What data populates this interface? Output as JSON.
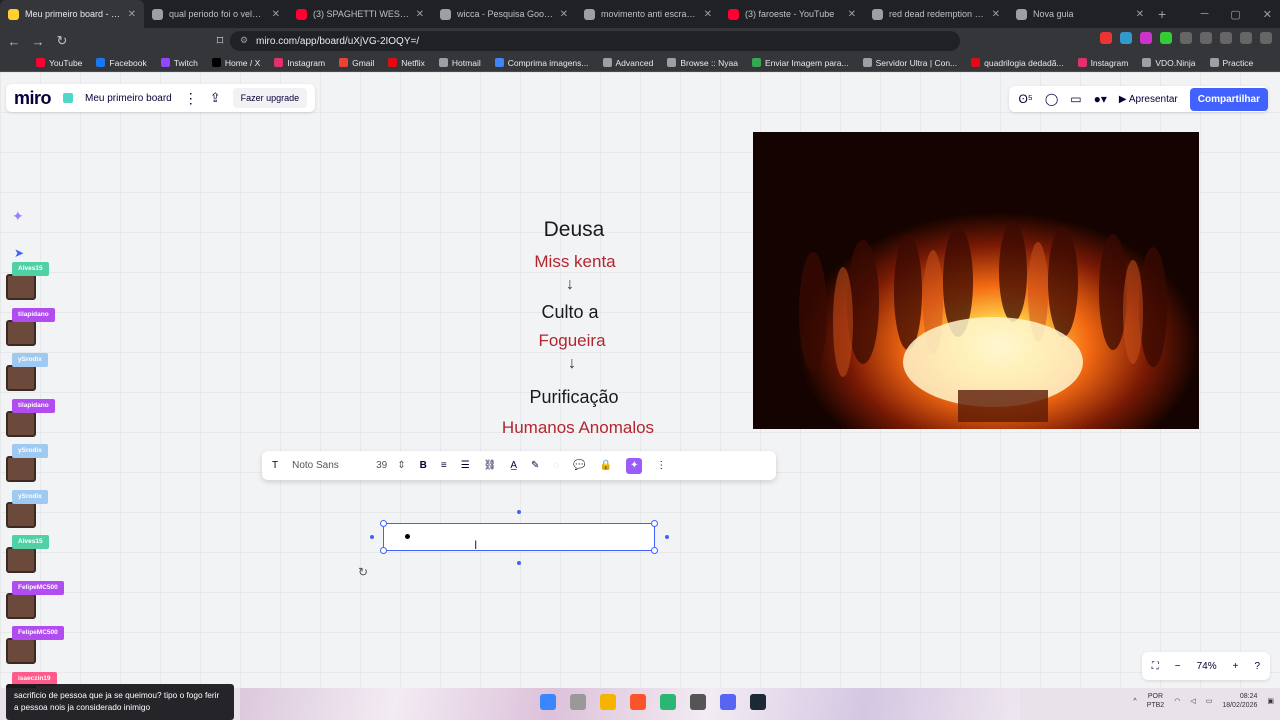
{
  "browser": {
    "tabs": [
      {
        "title": "Meu primeiro board - Miro",
        "color": "#ffd02f",
        "active": true
      },
      {
        "title": "qual periodo foi o velho oeste",
        "color": "#9aa0a6",
        "active": false
      },
      {
        "title": "(3) SPAGHETTI WESTERN BELLA",
        "color": "#ff0033",
        "active": false
      },
      {
        "title": "wicca - Pesquisa Google",
        "color": "#9aa0a6",
        "active": false
      },
      {
        "title": "movimento anti escravista - Pe",
        "color": "#9aa0a6",
        "active": false
      },
      {
        "title": "(3) faroeste - YouTube",
        "color": "#ff0033",
        "active": false
      },
      {
        "title": "red dead redemption 2 ritual -",
        "color": "#9aa0a6",
        "active": false
      },
      {
        "title": "Nova guia",
        "color": "#9aa0a6",
        "active": false
      }
    ],
    "url": "miro.com/app/board/uXjVG-2IOQY=/",
    "bookmarks": [
      {
        "label": "YouTube",
        "color": "#ff0033"
      },
      {
        "label": "Facebook",
        "color": "#1877f2"
      },
      {
        "label": "Twitch",
        "color": "#9146ff"
      },
      {
        "label": "Home / X",
        "color": "#000000"
      },
      {
        "label": "Instagram",
        "color": "#e1306c"
      },
      {
        "label": "Gmail",
        "color": "#ea4335"
      },
      {
        "label": "Netflix",
        "color": "#e50914"
      },
      {
        "label": "Hotmail",
        "color": "#9aa0a6"
      },
      {
        "label": "Comprima imagens...",
        "color": "#4285f4"
      },
      {
        "label": "Advanced",
        "color": "#9aa0a6"
      },
      {
        "label": "Browse :: Nyaa",
        "color": "#9aa0a6"
      },
      {
        "label": "Enviar Imagem para...",
        "color": "#34a853"
      },
      {
        "label": "Servidor Ultra | Con...",
        "color": "#9aa0a6"
      },
      {
        "label": "quadrilogia dedadã...",
        "color": "#e50914"
      },
      {
        "label": "Instagram",
        "color": "#e1306c"
      },
      {
        "label": "VDO.Ninja",
        "color": "#9aa0a6"
      },
      {
        "label": "Practice",
        "color": "#9aa0a6"
      }
    ]
  },
  "miro": {
    "logo": "miro",
    "board_name": "Meu primeiro board",
    "upgrade_label": "Fazer upgrade",
    "present_label": "Apresentar",
    "share_label": "Compartilhar",
    "accent": "#4262ff"
  },
  "mindmap": {
    "n1": "Deusa",
    "n1_sub": "Miss kenta",
    "n2": "Culto a",
    "n2_sub": "Fogueira",
    "n3": "Purificação",
    "n3_sub": "Humanos Anomalos",
    "arrow": "↓"
  },
  "format_toolbar": {
    "font": "Noto Sans",
    "size": "39"
  },
  "collaborators": [
    {
      "name": "Alves15",
      "color": "#4fd1a5"
    },
    {
      "name": "tilapidano",
      "color": "#b04cf0"
    },
    {
      "name": "ySrodix",
      "color": "#9ec9f0"
    },
    {
      "name": "tilapidano",
      "color": "#b04cf0"
    },
    {
      "name": "ySrodix",
      "color": "#9ec9f0"
    },
    {
      "name": "ySrodix",
      "color": "#9ec9f0"
    },
    {
      "name": "Alves15",
      "color": "#4fd1a5"
    },
    {
      "name": "FelipeMC500",
      "color": "#b04cf0"
    },
    {
      "name": "FelipeMC500",
      "color": "#b04cf0"
    },
    {
      "name": "isaeczin19",
      "color": "#ff5a8a"
    }
  ],
  "zoom": {
    "level": "74%"
  },
  "chat": {
    "message": "sacrificio de pessoa que ja se queimou? tipo o fogo ferir a pessoa nois ja considerado inimigo"
  },
  "taskbar": {
    "lang_top": "POR",
    "lang_bottom": "PTB2",
    "time": "08:24",
    "date": "18/02/2026"
  }
}
